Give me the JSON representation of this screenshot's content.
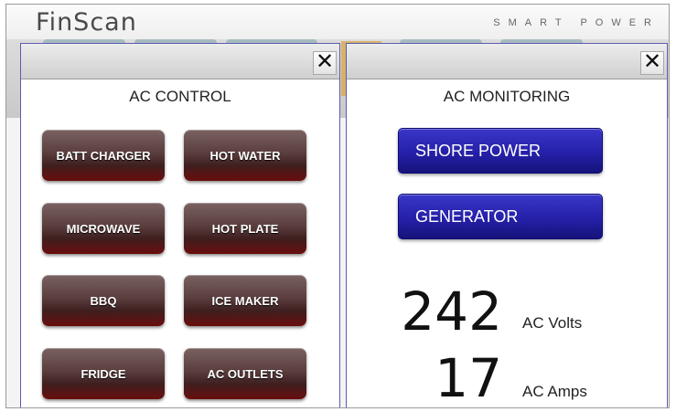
{
  "header": {
    "logo": "FinScan",
    "tagline": "SMART POWER"
  },
  "ac_control": {
    "title": "AC CONTROL",
    "close_label": "✕",
    "buttons": [
      "BATT CHARGER",
      "HOT WATER",
      "MICROWAVE",
      "HOT PLATE",
      "BBQ",
      "ICE MAKER",
      "FRIDGE",
      "AC OUTLETS"
    ]
  },
  "ac_monitoring": {
    "title": "AC MONITORING",
    "close_label": "✕",
    "shore_power_label": "SHORE POWER",
    "generator_label": "GENERATOR",
    "volts_value": "242",
    "volts_unit": "AC Volts",
    "amps_value": "17",
    "amps_unit": "AC Amps"
  },
  "colors": {
    "control_button": "#5b3e3e",
    "monitor_button": "#2520a8",
    "panel_border": "#5b5bb0"
  },
  "icons": {
    "close": "close-icon"
  }
}
